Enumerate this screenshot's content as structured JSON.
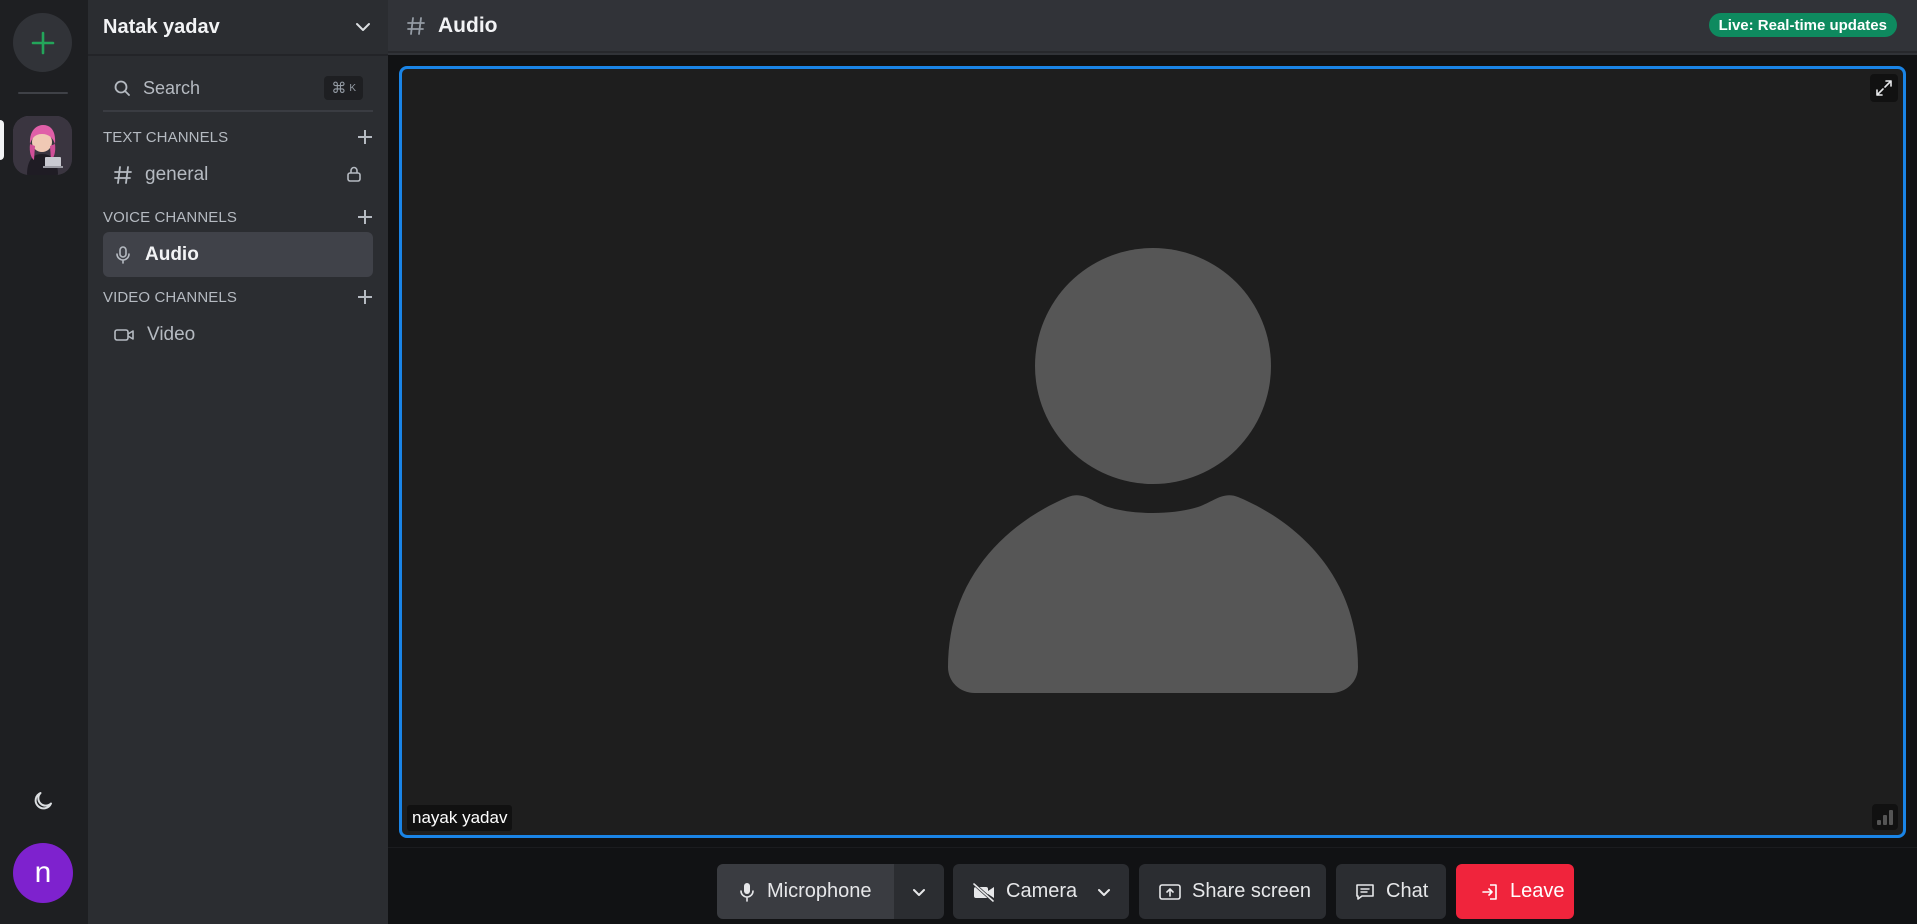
{
  "server": {
    "name": "Natak yadav"
  },
  "search": {
    "label": "Search",
    "shortcut_symbol": "⌘",
    "shortcut_key": "K"
  },
  "sections": {
    "text": "TEXT CHANNELS",
    "voice": "VOICE CHANNELS",
    "video": "VIDEO CHANNELS"
  },
  "channels": {
    "text": [
      {
        "label": "general",
        "icon": "hash-icon",
        "locked": true
      }
    ],
    "voice": [
      {
        "label": "Audio",
        "icon": "microphone-icon",
        "active": true
      }
    ],
    "video": [
      {
        "label": "Video",
        "icon": "video-camera-icon"
      }
    ]
  },
  "user": {
    "initial": "n"
  },
  "topbar": {
    "title": "Audio",
    "live_badge": "Live: Real-time updates"
  },
  "stage": {
    "participant_name": "nayak yadav"
  },
  "controls": {
    "microphone": "Microphone",
    "camera": "Camera",
    "share_screen": "Share screen",
    "chat": "Chat",
    "leave": "Leave"
  },
  "colors": {
    "accent_green": "#23a55a",
    "live_badge": "#0e8a5f",
    "tile_border": "#1a84e6",
    "leave_red": "#f0243c",
    "avatar_purple": "#7e22ce"
  }
}
